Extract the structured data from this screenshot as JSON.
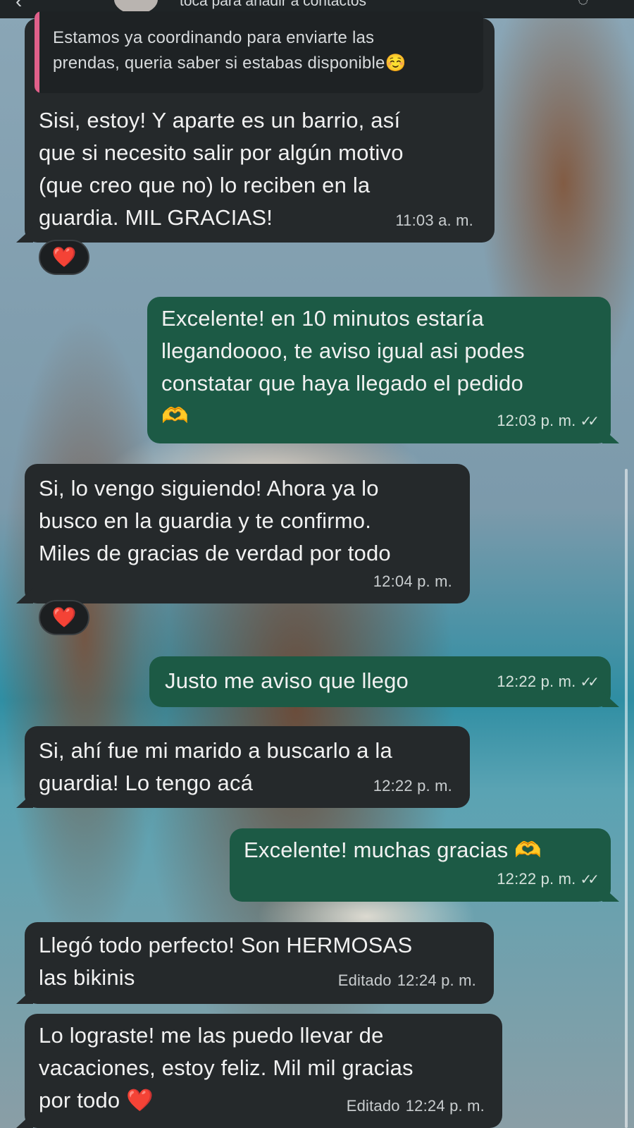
{
  "header": {
    "back_icon": "chevron-left-icon",
    "hint": "toca para añadir a contactos",
    "right_icon": "call-icon"
  },
  "messages": [
    {
      "direction": "in",
      "quote": "Estamos ya coordinando para enviarte las\nprendas, queria saber si estabas disponible☺️",
      "text": "Sisi, estoy! Y aparte es un barrio, así\nque si necesito salir por algún motivo\n(que creo que no) lo reciben en la\nguardia. MIL GRACIAS!",
      "time": "11:03 a. m.",
      "reaction": "❤️"
    },
    {
      "direction": "out",
      "text": "Excelente! en 10 minutos estaría\nllegandoooo, te aviso igual asi podes\nconstatar que haya llegado el pedido\n🫶",
      "time": "12:03 p. m.",
      "ticks": "✓✓"
    },
    {
      "direction": "in",
      "text": "Si, lo vengo siguiendo! Ahora ya lo\nbusco en la guardia y te confirmo.\nMiles de gracias de verdad por todo",
      "time": "12:04 p. m.",
      "reaction": "❤️"
    },
    {
      "direction": "out",
      "text": "Justo me aviso que llego",
      "time": "12:22 p. m.",
      "ticks": "✓✓"
    },
    {
      "direction": "in",
      "text": "Si, ahí fue mi marido a buscarlo a la\nguardia! Lo tengo acá",
      "time": "12:22 p. m."
    },
    {
      "direction": "out",
      "text": "Excelente! muchas gracias 🫶",
      "time": "12:22 p. m.",
      "ticks": "✓✓"
    },
    {
      "direction": "in",
      "text": "Llegó todo perfecto! Son HERMOSAS\nlas bikinis",
      "edited": "Editado",
      "time": "12:24 p. m."
    },
    {
      "direction": "in",
      "text": "Lo lograste! me las puedo llevar de\nvacaciones, estoy feliz. Mil mil gracias\npor todo ❤️",
      "edited": "Editado",
      "time": "12:24 p. m."
    }
  ],
  "colors": {
    "incoming_bubble": "#25292b",
    "outgoing_bubble": "#1c5a45",
    "quote_bar": "#e0608a"
  }
}
